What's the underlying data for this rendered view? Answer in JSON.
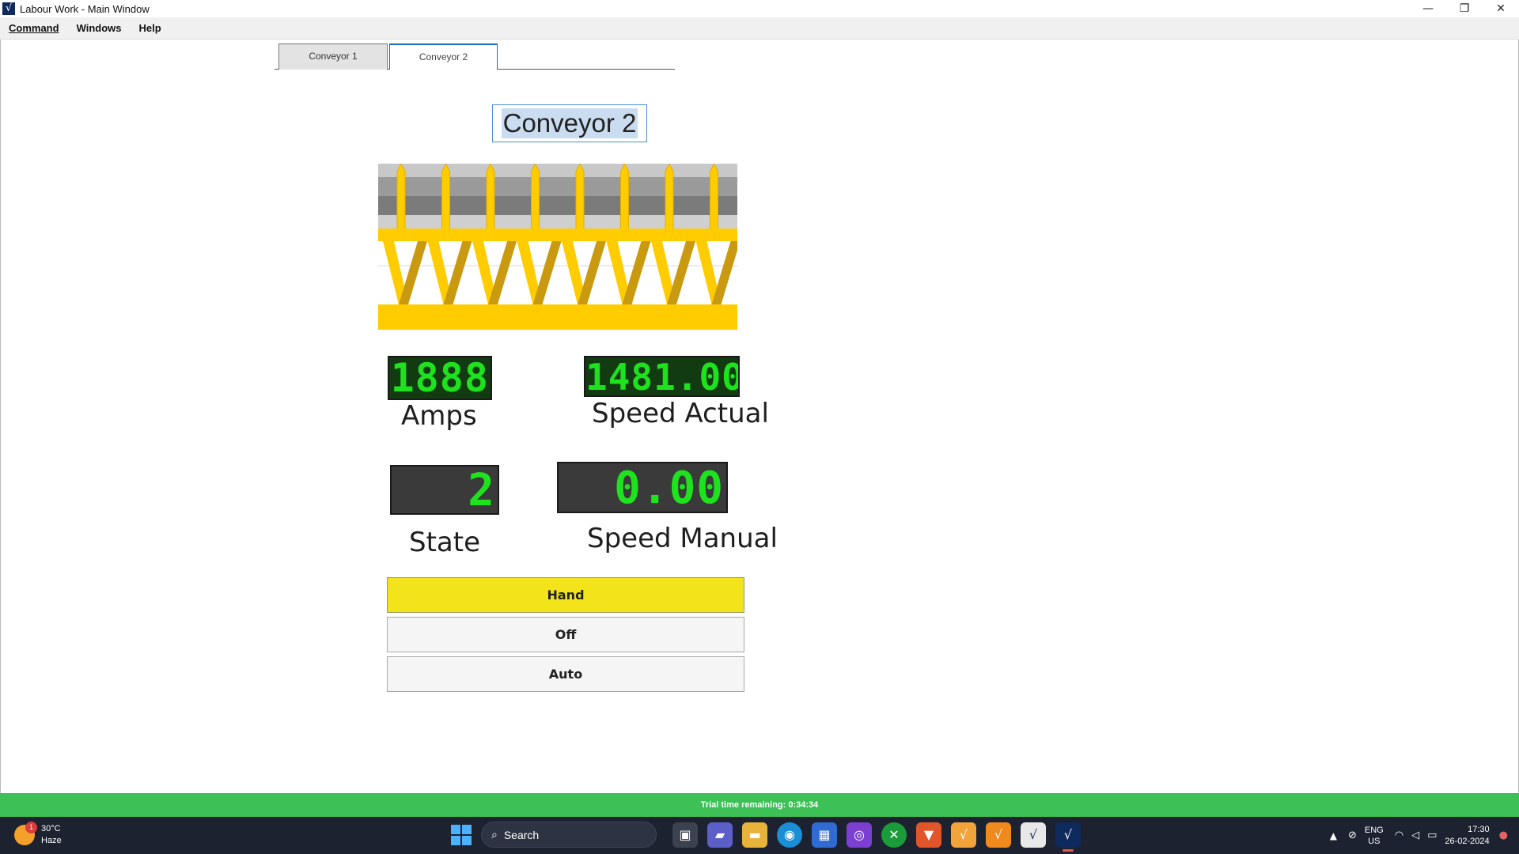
{
  "window": {
    "title": "Labour Work - Main Window",
    "app_icon_glyph": "√",
    "controls": {
      "minimize": "—",
      "restore": "❐",
      "close": "✕"
    }
  },
  "menubar": {
    "items": [
      "Command",
      "Windows",
      "Help"
    ]
  },
  "tabs": [
    {
      "label": "Conveyor 1",
      "selected": false
    },
    {
      "label": "Conveyor 2",
      "selected": true
    }
  ],
  "conveyor": {
    "name": "Conveyor 2",
    "colors": {
      "belt_gold": "#ffcc00",
      "belt_dark": "#c99a10",
      "rail_grey": "#9a9a9a"
    }
  },
  "readouts": {
    "amps": {
      "value": "1888",
      "label": "Amps"
    },
    "speed_actual": {
      "value": "1481.00",
      "label": "Speed Actual"
    },
    "state": {
      "value": "2",
      "label": "State"
    },
    "speed_manual": {
      "value": "0.00",
      "label": "Speed Manual"
    }
  },
  "mode_buttons": {
    "hand": "Hand",
    "off": "Off",
    "auto": "Auto",
    "active": "Hand"
  },
  "trial": {
    "text": "Trial time remaining: 0:34:34"
  },
  "taskbar": {
    "weather": {
      "temp": "30°C",
      "condition": "Haze",
      "badge": "1"
    },
    "search_label": "Search",
    "tray": {
      "lang_top": "ENG",
      "lang_bottom": "US",
      "time": "17:30",
      "date": "26-02-2024"
    }
  }
}
